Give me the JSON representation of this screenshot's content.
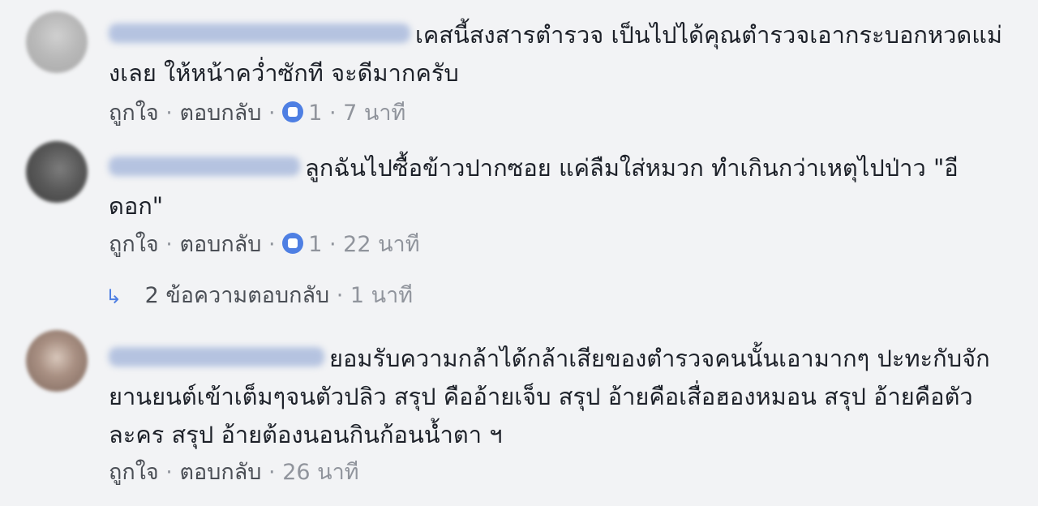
{
  "comments": [
    {
      "text": "เคสนี้สงสารตำรวจ เป็นไปได้คุณตำรวจเอากระบอกหวดแม่งเลย ให้หน้าคว่ำซักที จะดีมากครับ",
      "like_label": "ถูกใจ",
      "reply_label": "ตอบกลับ",
      "like_count": "1",
      "time": "7 นาที"
    },
    {
      "text": "ลูกฉันไปซื้อข้าวปากซอย แค่ลืมใส่หมวก ทำเกินกว่าเหตุไปป่าว \"อีดอก\"",
      "like_label": "ถูกใจ",
      "reply_label": "ตอบกลับ",
      "like_count": "1",
      "time": "22 นาที",
      "replies_summary": "2 ข้อความตอบกลับ",
      "replies_time": "1 นาที"
    },
    {
      "text": "ยอมรับความกล้าได้กล้าเสียของตำรวจคนนั้นเอามากๆ ปะทะกับจักยานยนต์เข้าเต็มๆจนตัวปลิว สรุป คืออ้ายเจ็บ สรุป อ้ายคือเสื่อฮองหมอน สรุป อ้ายคือตัวละคร สรุป อ้ายต้องนอนกินก้อนน้ำตา ฯ",
      "like_label": "ถูกใจ",
      "reply_label": "ตอบกลับ",
      "time": "26 นาที"
    }
  ],
  "separator": "·",
  "colors": {
    "background": "#f2f3f5",
    "text": "#1d2129",
    "meta": "#606770",
    "like_blue": "#4e7fe3"
  },
  "icons": {
    "like": "thumbs-up-icon",
    "reply_arrow": "reply-arrow-icon"
  }
}
